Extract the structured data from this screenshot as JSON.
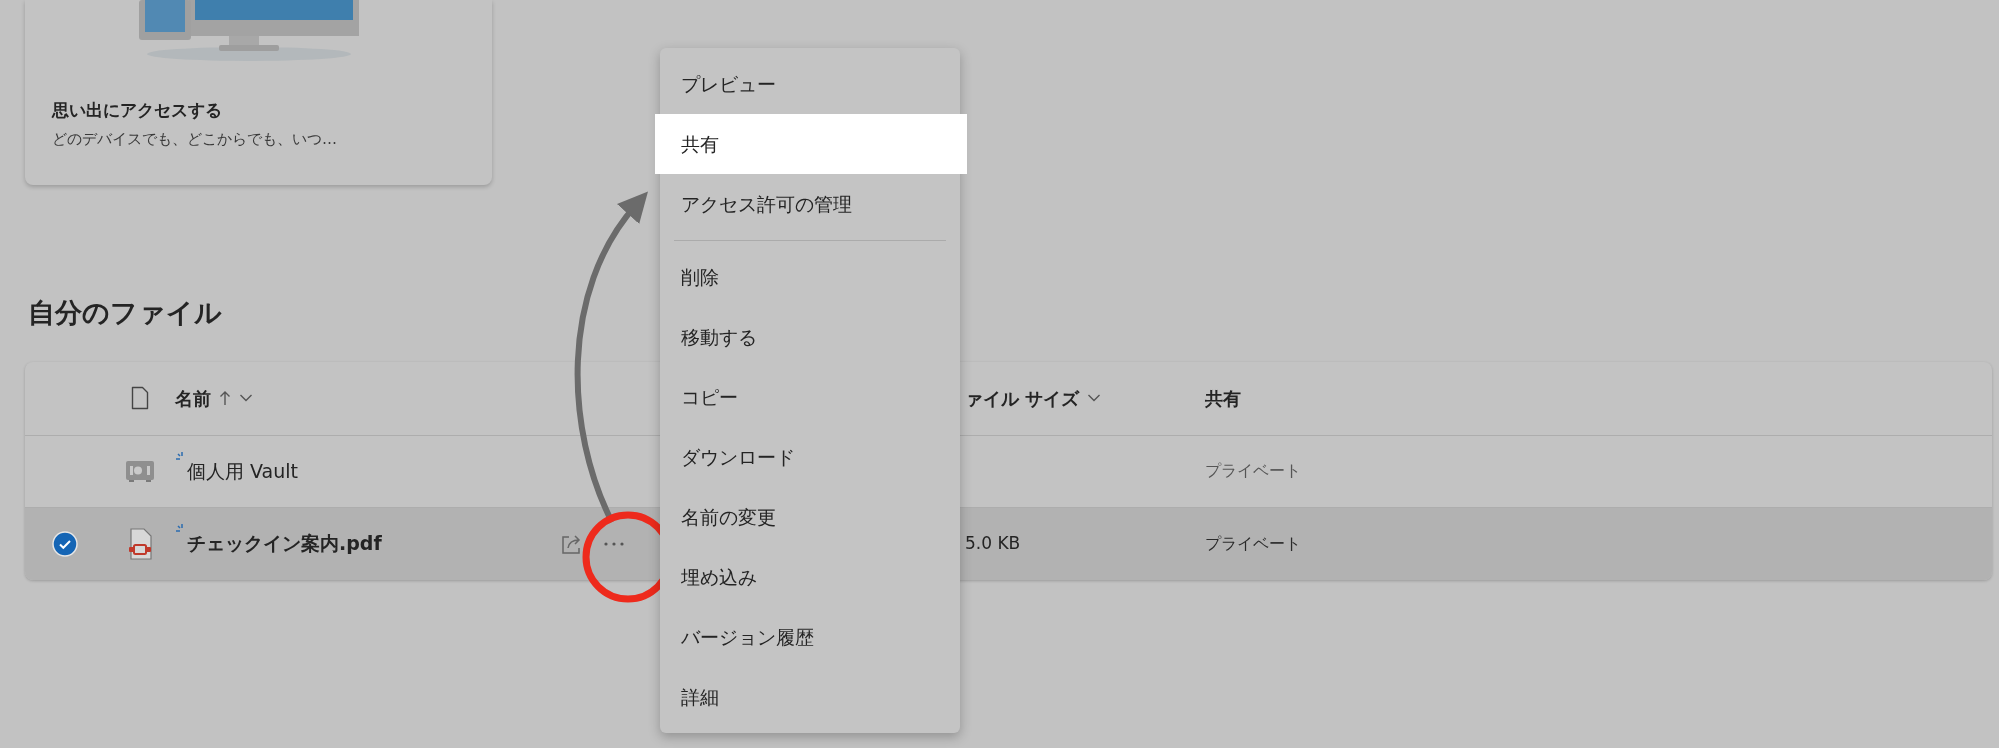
{
  "card": {
    "title": "思い出にアクセスする",
    "subtitle": "どのデバイスでも、どこからでも、いつ…"
  },
  "section_title": "自分のファイル",
  "table": {
    "columns": [
      {
        "label": "名前"
      },
      {
        "label": "ァイル サイズ"
      },
      {
        "label": "共有"
      }
    ],
    "rows": [
      {
        "kind": "vault",
        "name": "個人用 Vault",
        "new": true,
        "selected": false,
        "column_2": "",
        "sharing": "プライベート"
      },
      {
        "kind": "pdf",
        "name": "チェックイン案内.pdf",
        "new": true,
        "selected": true,
        "column_2": "5.0 KB",
        "sharing": "プライベート"
      }
    ]
  },
  "menu": {
    "items": [
      {
        "label": "プレビュー",
        "selected": false,
        "separator_after": false
      },
      {
        "label": "共有",
        "selected": true,
        "separator_after": false
      },
      {
        "label": "アクセス許可の管理",
        "selected": false,
        "separator_after": true
      },
      {
        "label": "削除",
        "selected": false,
        "separator_after": false
      },
      {
        "label": "移動する",
        "selected": false,
        "separator_after": false
      },
      {
        "label": "コピー",
        "selected": false,
        "separator_after": false
      },
      {
        "label": "ダウンロード",
        "selected": false,
        "separator_after": false
      },
      {
        "label": "名前の変更",
        "selected": false,
        "separator_after": false
      },
      {
        "label": "埋め込み",
        "selected": false,
        "separator_after": false
      },
      {
        "label": "バージョン履歴",
        "selected": false,
        "separator_after": false
      },
      {
        "label": "詳細",
        "selected": false,
        "separator_after": false
      }
    ]
  }
}
